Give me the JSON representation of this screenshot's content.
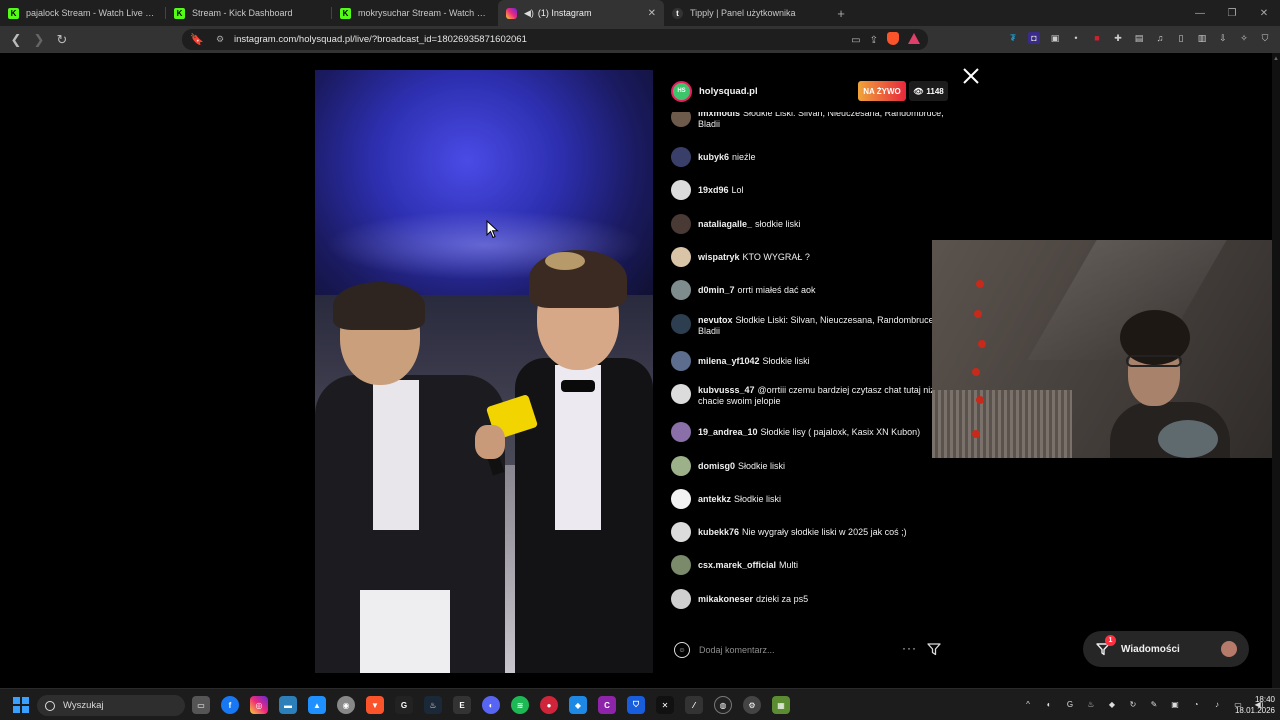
{
  "browser": {
    "tabs": [
      {
        "title": "pajalock Stream - Watch Live on Kick",
        "favicon": "kick"
      },
      {
        "title": "Stream - Kick Dashboard",
        "favicon": "kick"
      },
      {
        "title": "mokrysuchar Stream - Watch Live on",
        "favicon": "kick"
      },
      {
        "title": "(1) Instagram",
        "favicon": "instagram",
        "active": true
      },
      {
        "title": "Tipply | Panel użytkownika",
        "favicon": "tipply"
      }
    ],
    "url": "instagram.com/holysquad.pl/live/?broadcast_id=18026935871602061"
  },
  "live": {
    "username": "holysquad.pl",
    "live_label": "NA ŻYWO",
    "viewer_count": "1148",
    "comment_placeholder": "Dodaj komentarz..."
  },
  "comments": [
    {
      "user": "imxmodis",
      "text": "Słodkie Liski: Silvan, Nieuczesana, Randombruce, Bladii",
      "avatar_color": "#6e5a4a"
    },
    {
      "user": "kubyk6",
      "text": "nieźle",
      "avatar_color": "#3a3f6a"
    },
    {
      "user": "19xd96",
      "text": "Lol",
      "avatar_color": "#dcdcdc"
    },
    {
      "user": "nataliagalle_",
      "text": "słodkie liski",
      "avatar_color": "#4a3a36"
    },
    {
      "user": "wispatryk",
      "text": "KTO WYGRAŁ ?",
      "avatar_color": "#d9c4a8"
    },
    {
      "user": "d0min_7",
      "text": "orrti miałeś dać aok",
      "avatar_color": "#7f8c8d"
    },
    {
      "user": "nevutox",
      "text": "Słodkie Liski: Silvan, Nieuczesana, Randombruce, Bladii",
      "avatar_color": "#2c3e50"
    },
    {
      "user": "milena_yf1042",
      "text": "Słodkie liski",
      "avatar_color": "#5d6d8e"
    },
    {
      "user": "kubvusss_47",
      "text": "@orrtiii czemu bardziej czytasz chat tutaj niż na chacie swoim jelopie",
      "avatar_color": "#dcdcdc"
    },
    {
      "user": "19_andrea_10",
      "text": "Słodkie lisy ( pajaloxk, Kasix XN Kubon)",
      "avatar_color": "#8a6fa8"
    },
    {
      "user": "domisg0",
      "text": "Słodkie liski",
      "avatar_color": "#9cb08a"
    },
    {
      "user": "antekkz",
      "text": "Słodkie liski",
      "avatar_color": "#f2f2f2"
    },
    {
      "user": "kubekk76",
      "text": "Nie wygrały słodkie liski w 2025 jak coś ;)",
      "avatar_color": "#dcdcdc"
    },
    {
      "user": "csx.marek_official",
      "text": "Multi",
      "avatar_color": "#7a8a6a"
    },
    {
      "user": "mikakoneser",
      "text": "dzieki za ps5",
      "avatar_color": "#cfcfcf"
    }
  ],
  "messages_button": {
    "label": "Wiadomości",
    "badge": "1"
  },
  "taskbar": {
    "search_label": "Wyszukaj",
    "time": "18:40",
    "date": "18.01.2026"
  }
}
